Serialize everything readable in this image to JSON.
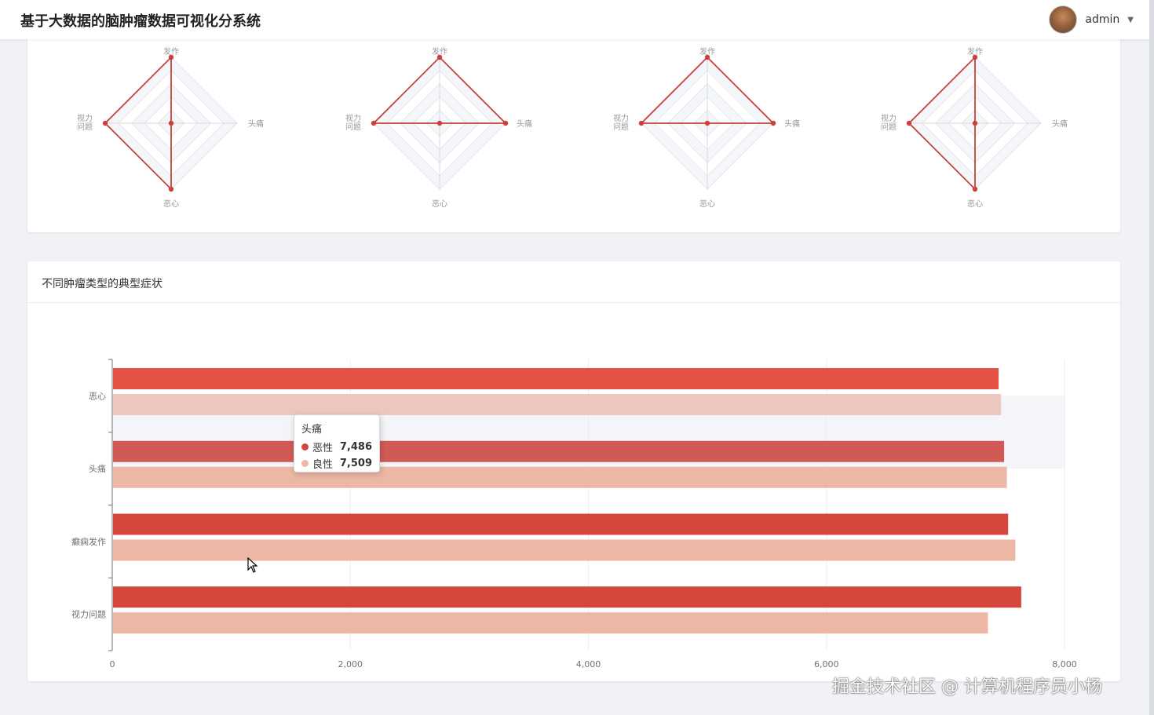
{
  "header": {
    "title": "基于大数据的脑肿瘤数据可视化分系统",
    "username": "admin"
  },
  "radar_card": {
    "indicators": [
      "发作",
      "头痛",
      "恶心",
      "视力问题"
    ]
  },
  "bar_card": {
    "title": "不同肿瘤类型的典型症状"
  },
  "tooltip": {
    "title": "头痛",
    "rows": [
      {
        "name": "恶性",
        "value": "7,486"
      },
      {
        "name": "良性",
        "value": "7,509"
      }
    ]
  },
  "watermark": "掘金技术社区 @ 计算机程序员小杨",
  "colors": {
    "malignant": "#d5473d",
    "benign": "#ecb7a4",
    "radar_line": "#c9413a",
    "axis": "#6e7079"
  },
  "chart_data": [
    {
      "type": "radar",
      "indicators": [
        "发作",
        "头痛",
        "恶心",
        "视力问题"
      ],
      "charts": [
        {
          "values": [
            1.0,
            0.0,
            1.0,
            1.0
          ]
        },
        {
          "values": [
            1.0,
            1.0,
            0.0,
            1.0
          ]
        },
        {
          "values": [
            1.0,
            1.0,
            0.0,
            1.0
          ]
        },
        {
          "values": [
            1.0,
            0.0,
            1.0,
            1.0
          ]
        }
      ]
    },
    {
      "type": "bar",
      "orientation": "horizontal",
      "categories": [
        "恶心",
        "头痛",
        "癫痫发作",
        "视力问题"
      ],
      "series": [
        {
          "name": "恶性",
          "values": [
            7440,
            7486,
            7520,
            7630
          ]
        },
        {
          "name": "良性",
          "values": [
            7460,
            7509,
            7580,
            7350
          ]
        }
      ],
      "x_ticks": [
        "0",
        "2,000",
        "4,000",
        "6,000",
        "8,000"
      ],
      "xlim": [
        0,
        8000
      ],
      "legend_position": "bottom-center",
      "grid": true
    }
  ]
}
